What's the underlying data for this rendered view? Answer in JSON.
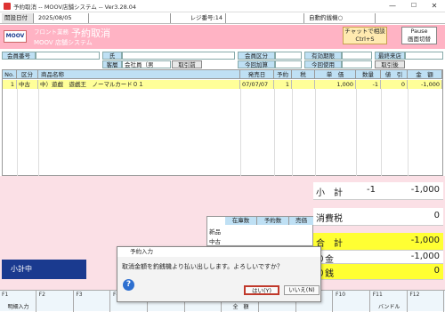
{
  "window": {
    "title": "予約取消 -- MOOV店舗システム -- Ver3.28.04",
    "min": "—",
    "max": "☐",
    "close": "✕"
  },
  "statusbar": {
    "date_label": "開設日付",
    "date_value": "2025/08/05",
    "register_label": "レジ番号:14",
    "auto_label": "自動釣銭機○"
  },
  "header": {
    "logo": "MOOV",
    "front": "フロント業務",
    "title": "予約取消",
    "system": "MOOV 店舗システム",
    "chat_line1": "チャットで相談",
    "chat_line2": "Ctrl+S",
    "pause_line1": "Pause",
    "pause_line2": "画面切替"
  },
  "customer": {
    "member_no_label": "会員番号",
    "member_no": "",
    "name_label": "氏　名",
    "name": "",
    "customer_label": "客層",
    "customer_value": "会社員（男",
    "search_btn": "取引前",
    "member_class_label": "会員区分",
    "member_class": "",
    "points_add_label": "今回加算",
    "points_add": "",
    "points_use_label": "今回使用",
    "points_use": "",
    "expiry_label": "有効期限",
    "expiry": "",
    "last_visit_label": "最終来店",
    "last_visit": "",
    "after_btn": "取引後"
  },
  "grid": {
    "headers": [
      "No.",
      "区分",
      "商品名称",
      "発売日",
      "予約",
      "税",
      "単　価",
      "数量",
      "値　引",
      "金　額"
    ],
    "rows": [
      {
        "no": "1",
        "class": "中古",
        "name": "中）遊戯　遊戯王　ノーマルカード０１",
        "release": "07/07/07",
        "reserve": "1",
        "tax": "",
        "price": "1,000",
        "qty": "-1",
        "discount": "0",
        "amount": "-1,000"
      }
    ]
  },
  "stock": {
    "headers": [
      "在庫数",
      "予約数",
      "売価"
    ],
    "rows": [
      "新品",
      "中古"
    ]
  },
  "subtotal_label": "小計中",
  "summary": {
    "subtotal_label": "小　計",
    "subtotal_qty": "-1",
    "subtotal_value": "-1,000",
    "tax_label": "消費税",
    "tax_value": "0",
    "total_label": "合　計",
    "total_value": "-1,000",
    "deposit_label": "り金",
    "deposit_value": "-1,000",
    "change_label": "り銭",
    "change_value": "0"
  },
  "fkeys": [
    {
      "key": "F1",
      "label": "明細入力"
    },
    {
      "key": "F2",
      "label": ""
    },
    {
      "key": "F3",
      "label": ""
    },
    {
      "key": "F4",
      "label": ""
    },
    {
      "key": "F5",
      "label": ""
    },
    {
      "key": "F6",
      "label": ""
    },
    {
      "key": "F7",
      "label": "全　額"
    },
    {
      "key": "F8",
      "label": ""
    },
    {
      "key": "F9",
      "label": ""
    },
    {
      "key": "F10",
      "label": ""
    },
    {
      "key": "F11",
      "label": "バンドル"
    },
    {
      "key": "F12",
      "label": ""
    }
  ],
  "dialog": {
    "title": "予約入力",
    "message": "取消金額を釣銭機より払い出しします。よろしいですか？",
    "yes": "はい(Y)",
    "no": "いいえ(N)"
  },
  "colors": {
    "header": "#ffb3c4",
    "panel": "#fbe0e6",
    "grid_header": "#bfe0f4",
    "row_highlight": "#ffff99",
    "total_highlight": "#ffff33",
    "subtotal_label_bg": "#1a3a8f"
  }
}
